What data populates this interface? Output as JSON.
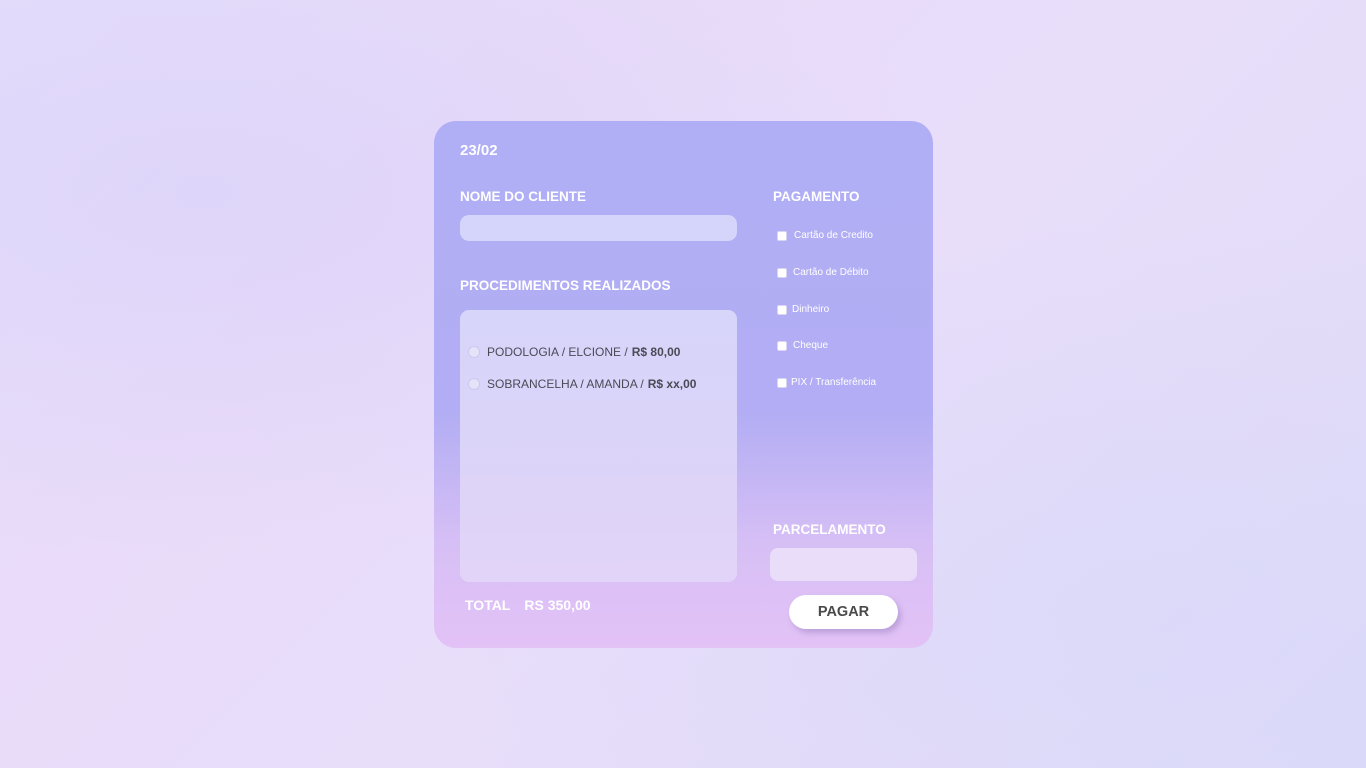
{
  "form": {
    "date": "23/02",
    "client_label": "NOME DO CLIENTE",
    "client_value": "",
    "procedures_label": "PROCEDIMENTOS REALIZADOS",
    "procedures": [
      {
        "service": "PODOLOGIA / ELCIONE /",
        "price": "R$ 80,00"
      },
      {
        "service": "SOBRANCELHA / AMANDA /",
        "price": "R$ xx,00"
      }
    ],
    "payment_label": "PAGAMENTO",
    "payment_options": [
      "Cartão de Credito",
      "Cartão de Débito",
      "Dinheiro",
      "Cheque",
      "PIX / Transferência"
    ],
    "installments_label": "PARCELAMENTO",
    "installments_value": "",
    "total_label": "TOTAL",
    "total_value": "RS 350,00",
    "pay_button": "PAGAR"
  },
  "colors": {
    "card_top": "#b0aef5",
    "card_bottom": "#e3c2f6",
    "text": "#ffffff",
    "button_bg": "#ffffff",
    "button_text": "#4a4a4a"
  }
}
